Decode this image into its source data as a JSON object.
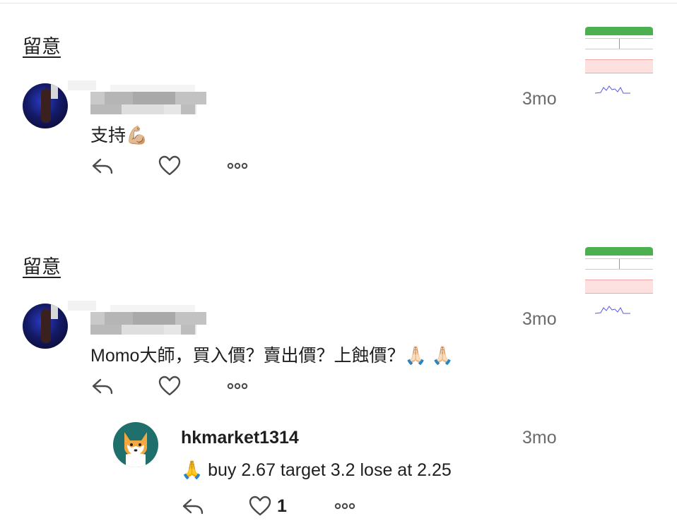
{
  "posts": [
    {
      "title": "留意",
      "timestamp": "3mo",
      "comment": "支持💪🏼",
      "icons": {
        "reply": "reply-arrow-icon",
        "like": "heart-icon",
        "more": "more-dots-icon"
      }
    },
    {
      "title": "留意",
      "timestamp": "3mo",
      "comment": "Momo大師，買入價？賣出價？上蝕價？🙏🏻 🙏🏻",
      "icons": {
        "reply": "reply-arrow-icon",
        "like": "heart-icon",
        "more": "more-dots-icon"
      },
      "reply": {
        "username": "hkmarket1314",
        "timestamp": "3mo",
        "text": "🙏 buy 2.67 target 3.2 lose at 2.25",
        "like_count": "1"
      }
    }
  ],
  "colors": {
    "thumb_header": "#4caf50",
    "thumb_highlight": "#fde0e0",
    "reply_avatar": "#1f6f6c",
    "muted_text": "#6b6b6b"
  }
}
